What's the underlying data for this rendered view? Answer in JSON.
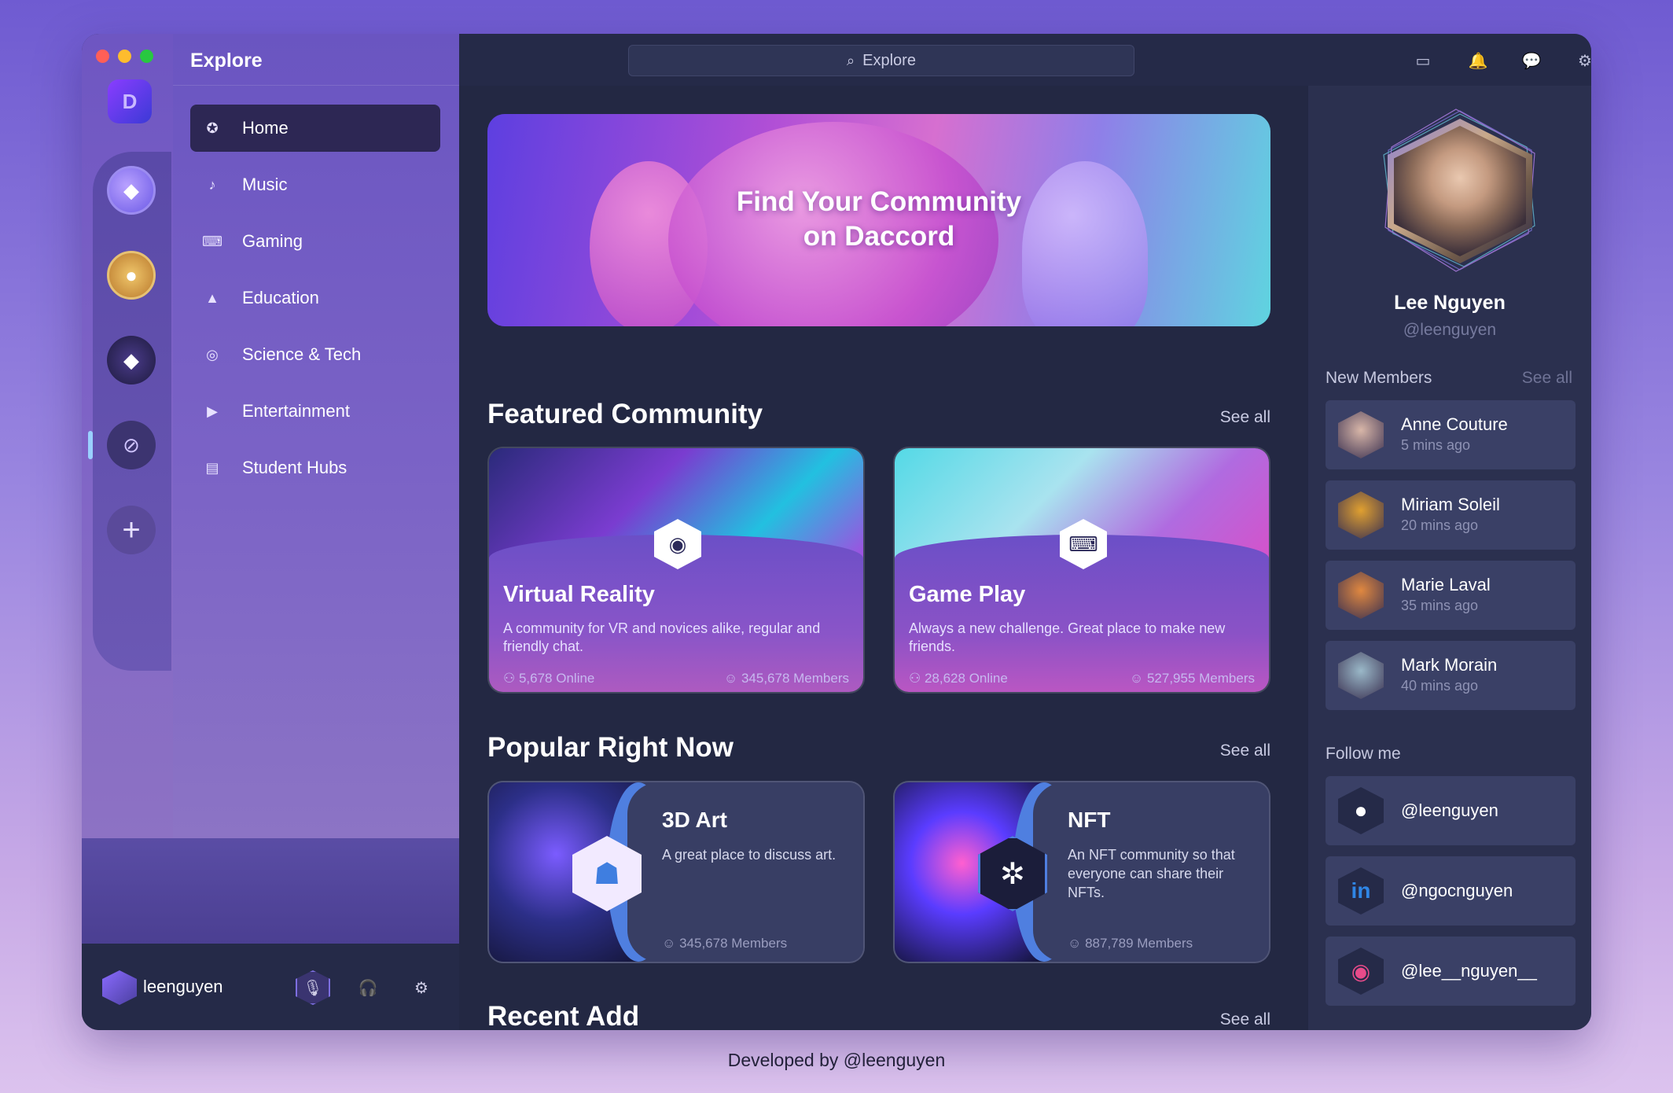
{
  "sidebar": {
    "title": "Explore",
    "items": [
      {
        "label": "Home",
        "icon": "compass-icon",
        "glyph": "✪"
      },
      {
        "label": "Music",
        "icon": "music-icon",
        "glyph": "♪"
      },
      {
        "label": "Gaming",
        "icon": "gamepad-icon",
        "glyph": "⌨"
      },
      {
        "label": "Education",
        "icon": "graduation-cap-icon",
        "glyph": "▲"
      },
      {
        "label": "Science & Tech",
        "icon": "globe-icon",
        "glyph": "◎"
      },
      {
        "label": "Entertainment",
        "icon": "play-icon",
        "glyph": "▶"
      },
      {
        "label": "Student Hubs",
        "icon": "building-icon",
        "glyph": "▤"
      }
    ],
    "active": "Home"
  },
  "user": {
    "name": "leenguyen"
  },
  "search": {
    "label": "Explore"
  },
  "hero": {
    "line1": "Find Your Community",
    "line2": "on Daccord"
  },
  "featured": {
    "title": "Featured Community",
    "see_all": "See all",
    "cards": [
      {
        "title": "Virtual Reality",
        "desc": "A community for VR and novices alike, regular and friendly chat.",
        "online": "5,678 Online",
        "members": "345,678 Members"
      },
      {
        "title": "Game Play",
        "desc": "Always a new challenge. Great place to make new friends.",
        "online": "28,628 Online",
        "members": "527,955 Members"
      }
    ]
  },
  "popular": {
    "title": "Popular Right Now",
    "see_all": "See all",
    "cards": [
      {
        "title": "3D Art",
        "desc": "A great place to discuss art.",
        "members": "345,678 Members"
      },
      {
        "title": "NFT",
        "desc": "An NFT community so that everyone can share their NFTs.",
        "members": "887,789 Members"
      }
    ]
  },
  "recent": {
    "title": "Recent Add",
    "see_all": "See all"
  },
  "profile": {
    "name": "Lee Nguyen",
    "handle": "@leenguyen"
  },
  "new_members": {
    "title": "New Members",
    "see_all": "See all",
    "items": [
      {
        "name": "Anne Couture",
        "time": "5 mins ago",
        "color": "#d8b6a8"
      },
      {
        "name": "Miriam Soleil",
        "time": "20 mins ago",
        "color": "#e0a030"
      },
      {
        "name": "Marie Laval",
        "time": "35 mins ago",
        "color": "#e08840"
      },
      {
        "name": "Mark Morain",
        "time": "40 mins ago",
        "color": "#9ab8c8"
      }
    ]
  },
  "follow": {
    "title": "Follow me",
    "items": [
      {
        "handle": "@leenguyen",
        "icon": "github-icon",
        "glyph": "●",
        "color": "#ffffff"
      },
      {
        "handle": "@ngocnguyen",
        "icon": "linkedin-icon",
        "glyph": "in",
        "color": "#2f86e6"
      },
      {
        "handle": "@lee__nguyen__",
        "icon": "instagram-icon",
        "glyph": "◉",
        "color": "#e84b8a"
      }
    ]
  },
  "footer": "Developed by @leenguyen"
}
